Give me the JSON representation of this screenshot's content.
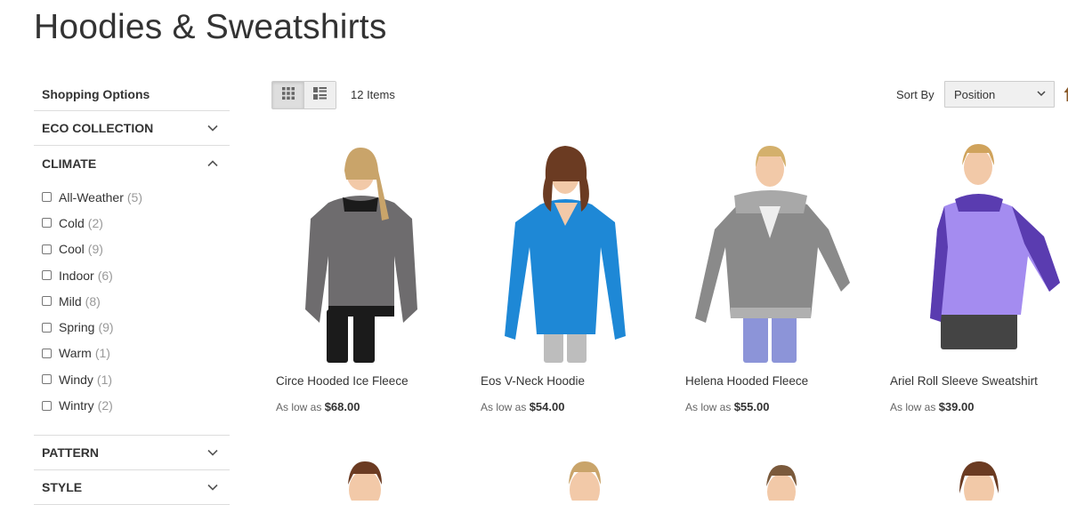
{
  "page": {
    "title": "Hoodies & Sweatshirts"
  },
  "sidebar": {
    "heading": "Shopping Options",
    "filters": [
      {
        "label": "ECO COLLECTION",
        "state": "collapsed"
      },
      {
        "label": "CLIMATE",
        "state": "expanded"
      },
      {
        "label": "PATTERN",
        "state": "collapsed"
      },
      {
        "label": "STYLE",
        "state": "collapsed"
      }
    ],
    "climate_options": [
      {
        "label": "All-Weather",
        "count": "(5)"
      },
      {
        "label": "Cold",
        "count": "(2)"
      },
      {
        "label": "Cool",
        "count": "(9)"
      },
      {
        "label": "Indoor",
        "count": "(6)"
      },
      {
        "label": "Mild",
        "count": "(8)"
      },
      {
        "label": "Spring",
        "count": "(9)"
      },
      {
        "label": "Warm",
        "count": "(1)"
      },
      {
        "label": "Windy",
        "count": "(1)"
      },
      {
        "label": "Wintry",
        "count": "(2)"
      }
    ]
  },
  "toolbar": {
    "items_count": "12 Items",
    "sort_label": "Sort By",
    "sort_value": "Position",
    "view_modes": [
      "grid-icon",
      "list-icon"
    ],
    "active_mode": "grid"
  },
  "products": [
    {
      "name": "Circe Hooded Ice Fleece",
      "price_prefix": "As low as",
      "price": "$68.00",
      "colors": {
        "top": "#6e6c6e",
        "bottoms": "#1b1b1b",
        "hair": "#c9a46a"
      }
    },
    {
      "name": "Eos V-Neck Hoodie",
      "price_prefix": "As low as",
      "price": "$54.00",
      "colors": {
        "top": "#1e88d6",
        "bottoms": "#bdbdbd",
        "hair": "#6b3b22"
      }
    },
    {
      "name": "Helena Hooded Fleece",
      "price_prefix": "As low as",
      "price": "$55.00",
      "colors": {
        "top": "#8a8a8a",
        "bottoms": "#8c94d8",
        "hair": "#d4b06c"
      }
    },
    {
      "name": "Ariel Roll Sleeve Sweatshirt",
      "price_prefix": "As low as",
      "price": "$39.00",
      "colors": {
        "top": "#a48cf0",
        "bottoms": "#444444",
        "hair": "#d0a35c"
      }
    }
  ],
  "bottom_row_hair": [
    "#6b3b22",
    "#c9a46a",
    "#7b5a3c",
    "#6b3b22"
  ]
}
